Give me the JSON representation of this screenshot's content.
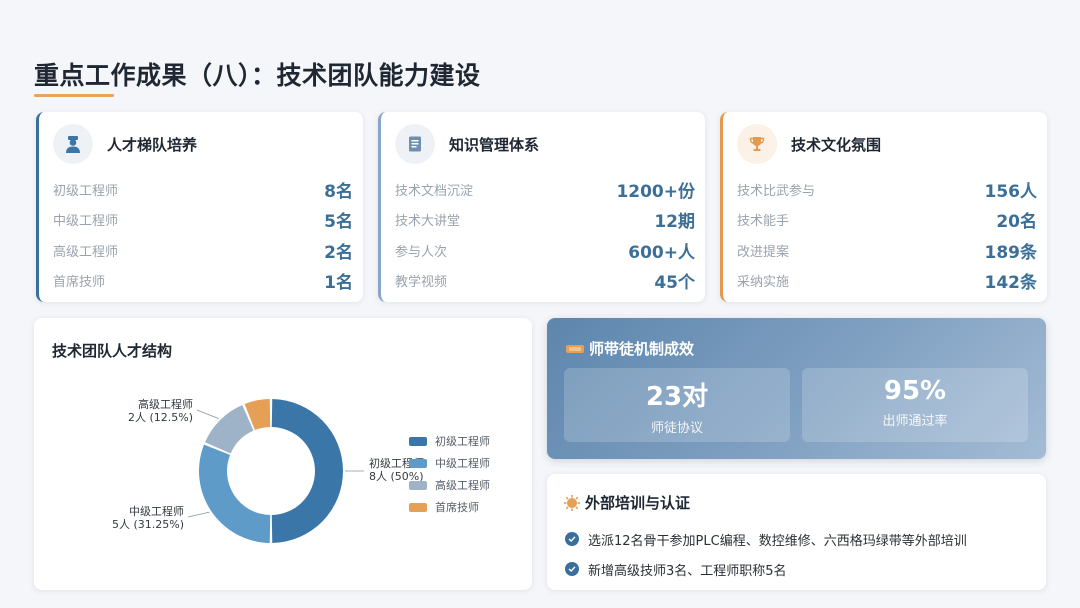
{
  "page": {
    "title": "重点工作成果（八）：技术团队能力建设"
  },
  "cards": [
    {
      "title": "人才梯队培养",
      "icon": "engineer-icon",
      "rows": [
        {
          "label": "初级工程师",
          "value": "8名"
        },
        {
          "label": "中级工程师",
          "value": "5名"
        },
        {
          "label": "高级工程师",
          "value": "2名"
        },
        {
          "label": "首席技师",
          "value": "1名"
        }
      ]
    },
    {
      "title": "知识管理体系",
      "icon": "book-icon",
      "rows": [
        {
          "label": "技术文档沉淀",
          "value": "1200+份"
        },
        {
          "label": "技术大讲堂",
          "value": "12期"
        },
        {
          "label": "参与人次",
          "value": "600+人"
        },
        {
          "label": "教学视频",
          "value": "45个"
        }
      ]
    },
    {
      "title": "技术文化氛围",
      "icon": "trophy-icon",
      "rows": [
        {
          "label": "技术比武参与",
          "value": "156人"
        },
        {
          "label": "技术能手",
          "value": "20名"
        },
        {
          "label": "改进提案",
          "value": "189条"
        },
        {
          "label": "采纳实施",
          "value": "142条"
        }
      ]
    }
  ],
  "chart": {
    "title": "技术团队人才结构"
  },
  "chart_data": {
    "type": "pie",
    "donut": true,
    "categories": [
      "初级工程师",
      "中级工程师",
      "高级工程师",
      "首席技师"
    ],
    "values": [
      8,
      5,
      2,
      1
    ],
    "percents": [
      "50%",
      "31.25%",
      "12.5%",
      "6.25%"
    ],
    "data_labels": [
      {
        "name": "初级工程师",
        "text": "8人 (50%)"
      },
      {
        "name": "中级工程师",
        "text": "5人 (31.25%)"
      },
      {
        "name": "高级工程师",
        "text": "2人 (12.5%)"
      }
    ],
    "colors": [
      "#3a77a8",
      "#5f9bc9",
      "#9fb3c8",
      "#e6a055"
    ],
    "legend_position": "right"
  },
  "mentor": {
    "title": "师带徒机制成效",
    "icon": "handshake-icon",
    "stats": [
      {
        "value": "23对",
        "label": "师徒协议"
      },
      {
        "value": "95%",
        "label": "出师通过率"
      }
    ]
  },
  "training": {
    "title": "外部培训与认证",
    "icon": "badge-icon",
    "items": [
      "选派12名骨干参加PLC编程、数控维修、六西格玛绿带等外部培训",
      "新增高级技师3名、工程师职称5名"
    ]
  }
}
